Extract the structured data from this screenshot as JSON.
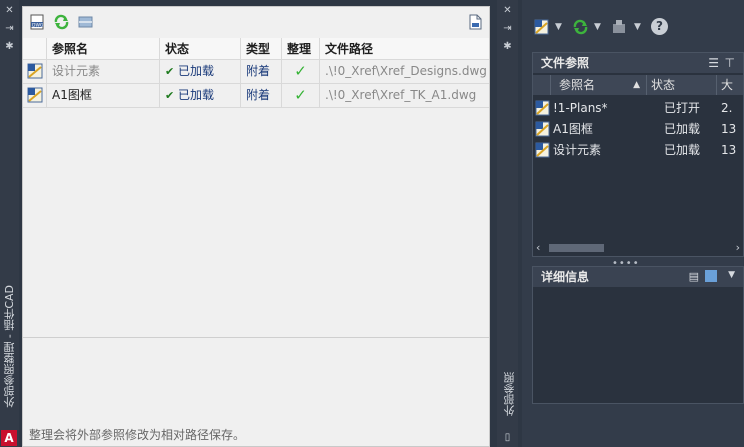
{
  "left_strip": {
    "title": "外部参照整理 - 插件CAD",
    "logo": "A"
  },
  "left_palette": {
    "columns": [
      "参照名",
      "状态",
      "类型",
      "整理",
      "文件路径"
    ],
    "rows": [
      {
        "name": "设计元素",
        "status": "已加载",
        "type": "附着",
        "path": ".\\!0_Xref\\Xref_Designs.dwg"
      },
      {
        "name": "A1图框",
        "status": "已加载",
        "type": "附着",
        "path": ".\\!0_Xref\\Xref_TK_A1.dwg"
      }
    ],
    "footer": "整理会将外部参照修改为相对路径保存。"
  },
  "middle_strip": {
    "title": "外部参照"
  },
  "right_panel": {
    "file_refs": {
      "title": "文件参照",
      "columns": [
        "参照名",
        "状态"
      ],
      "col3_cut": "大",
      "items": [
        {
          "name": "!1-Plans*",
          "status": "已打开",
          "extra": "2."
        },
        {
          "name": "A1图框",
          "status": "已加载",
          "extra": "13"
        },
        {
          "name": "设计元素",
          "status": "已加载",
          "extra": "13"
        }
      ]
    },
    "details": {
      "title": "详细信息"
    },
    "help_label": "?"
  },
  "colors": {
    "refresh_green": "#3db33d",
    "check_green": "#36b336",
    "accent_blue": "#2a6bd6"
  }
}
